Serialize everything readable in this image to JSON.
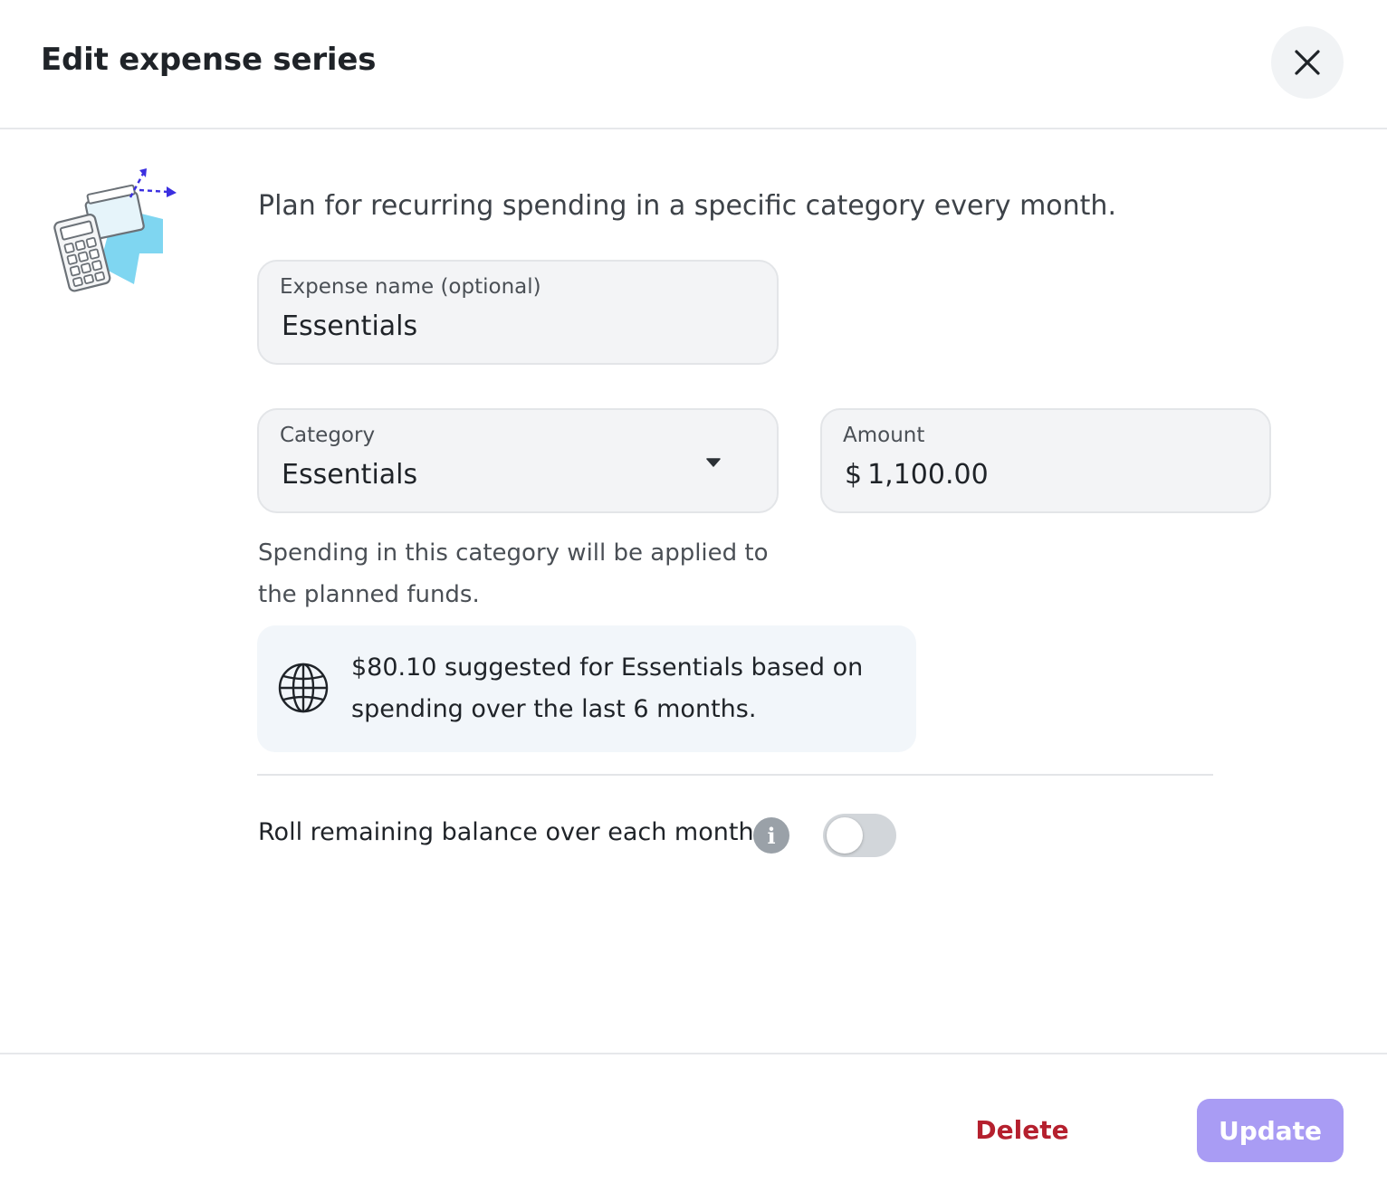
{
  "dialog": {
    "title": "Edit expense series",
    "close_icon": "close-icon"
  },
  "intro": {
    "illustration_icon": "calculator-cards-illustration",
    "text": "Plan for recurring spending in a specific category every month."
  },
  "expense_name": {
    "label": "Expense name (optional)",
    "value": "Essentials"
  },
  "category": {
    "label": "Category",
    "value": "Essentials",
    "caret_icon": "caret-down-icon"
  },
  "amount": {
    "label": "Amount",
    "currency_symbol": "$",
    "value": "1,100.00"
  },
  "help_text": "Spending in this category will be applied to the planned funds.",
  "suggestion": {
    "icon": "globe-icon",
    "text": "$80.10 suggested for Essentials based on spending over the last 6 months."
  },
  "rollover": {
    "label": "Roll remaining balance over each month.",
    "info_icon": "info-icon",
    "info_glyph": "i",
    "enabled": false
  },
  "footer": {
    "delete_label": "Delete",
    "update_label": "Update"
  },
  "colors": {
    "danger": "#b5202e",
    "primary_disabled": "#a99cf4",
    "field_background": "#f3f4f6",
    "suggestion_background": "#f2f6fa",
    "toggle_off": "#d2d6da"
  }
}
